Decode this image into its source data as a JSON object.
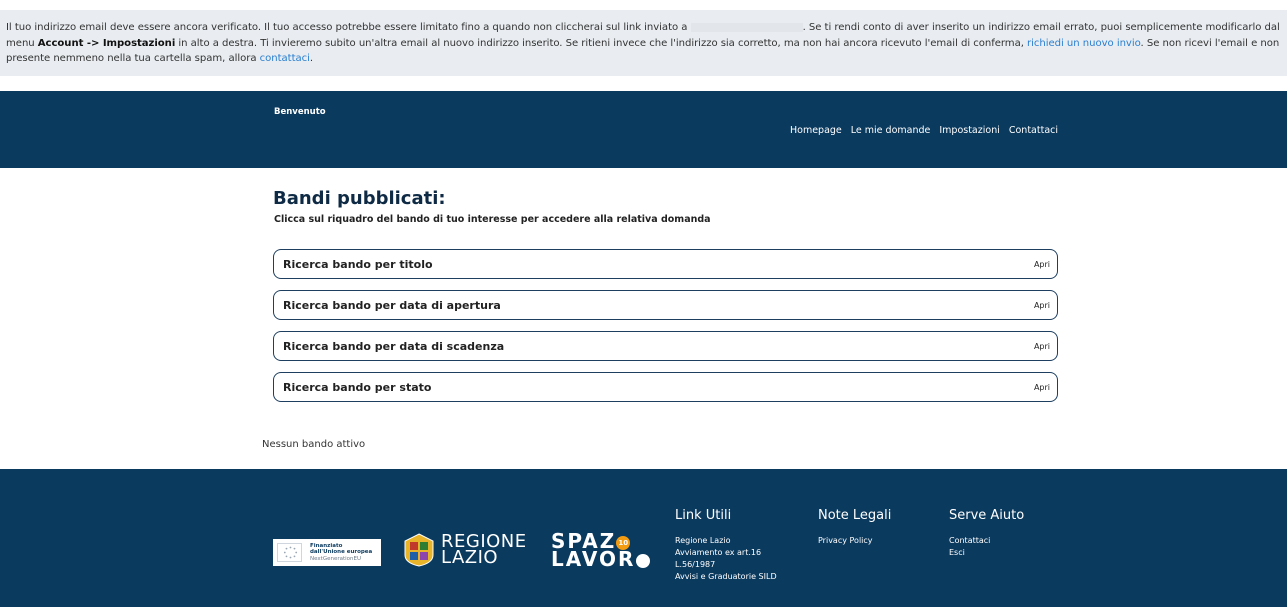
{
  "notice": {
    "line1_a": "Il tuo indirizzo email deve essere ancora verificato. Il tuo accesso potrebbe essere limitato fino a quando non cliccherai sul link inviato a ",
    "line1_b": ". Se ti rendi conto di aver inserito un indirizzo email errato, puoi semplicemente modificarlo dal",
    "line2_a": "menu ",
    "line2_bold": "Account -> Impostazioni",
    "line2_b": " in alto a destra. Ti invieremo subito un'altra email al nuovo indirizzo inserito. Se ritieni invece che l'indirizzo sia corretto, ma non hai ancora ricevuto l'email di conferma, ",
    "line2_link": "richiedi un nuovo invio",
    "line2_c": ". Se non ricevi l'email e non è",
    "line3_a": "presente nemmeno nella tua cartella spam, allora ",
    "line3_link": "contattaci",
    "line3_b": "."
  },
  "header": {
    "welcome": "Benvenuto",
    "nav": [
      "Homepage",
      "Le mie domande",
      "Impostazioni",
      "Contattaci"
    ]
  },
  "main": {
    "title": "Bandi pubblicati:",
    "subtitle": "Clicca sul riquadro del bando di tuo interesse per accedere alla relativa domanda",
    "searches": [
      {
        "label": "Ricerca bando per titolo",
        "action": "Apri"
      },
      {
        "label": "Ricerca bando per data di apertura",
        "action": "Apri"
      },
      {
        "label": "Ricerca bando per data di scadenza",
        "action": "Apri"
      },
      {
        "label": "Ricerca bando per stato",
        "action": "Apri"
      }
    ],
    "empty_message": "Nessun bando attivo"
  },
  "footer": {
    "eu_logo": {
      "line1": "Finanziato",
      "line2": "dall'Unione europea",
      "line3": "NextGenerationEU"
    },
    "region_logo": {
      "line1": "REGIONE",
      "line2": "LAZIO"
    },
    "spazio_logo": {
      "line1": "SPAZ",
      "line2": "LAVOR",
      "badge": "10"
    },
    "columns": [
      {
        "title": "Link Utili",
        "links": [
          "Regione Lazio",
          "Avviamento ex art.16 L.56/1987",
          "Avvisi e Graduatorie SILD"
        ]
      },
      {
        "title": "Note Legali",
        "links": [
          "Privacy Policy"
        ]
      },
      {
        "title": "Serve Aiuto",
        "links": [
          "Contattaci",
          "Esci"
        ]
      }
    ]
  },
  "colors": {
    "navy": "#0b3a5f",
    "link_blue": "#2a7fd1",
    "notice_bg": "#e9edf1"
  }
}
